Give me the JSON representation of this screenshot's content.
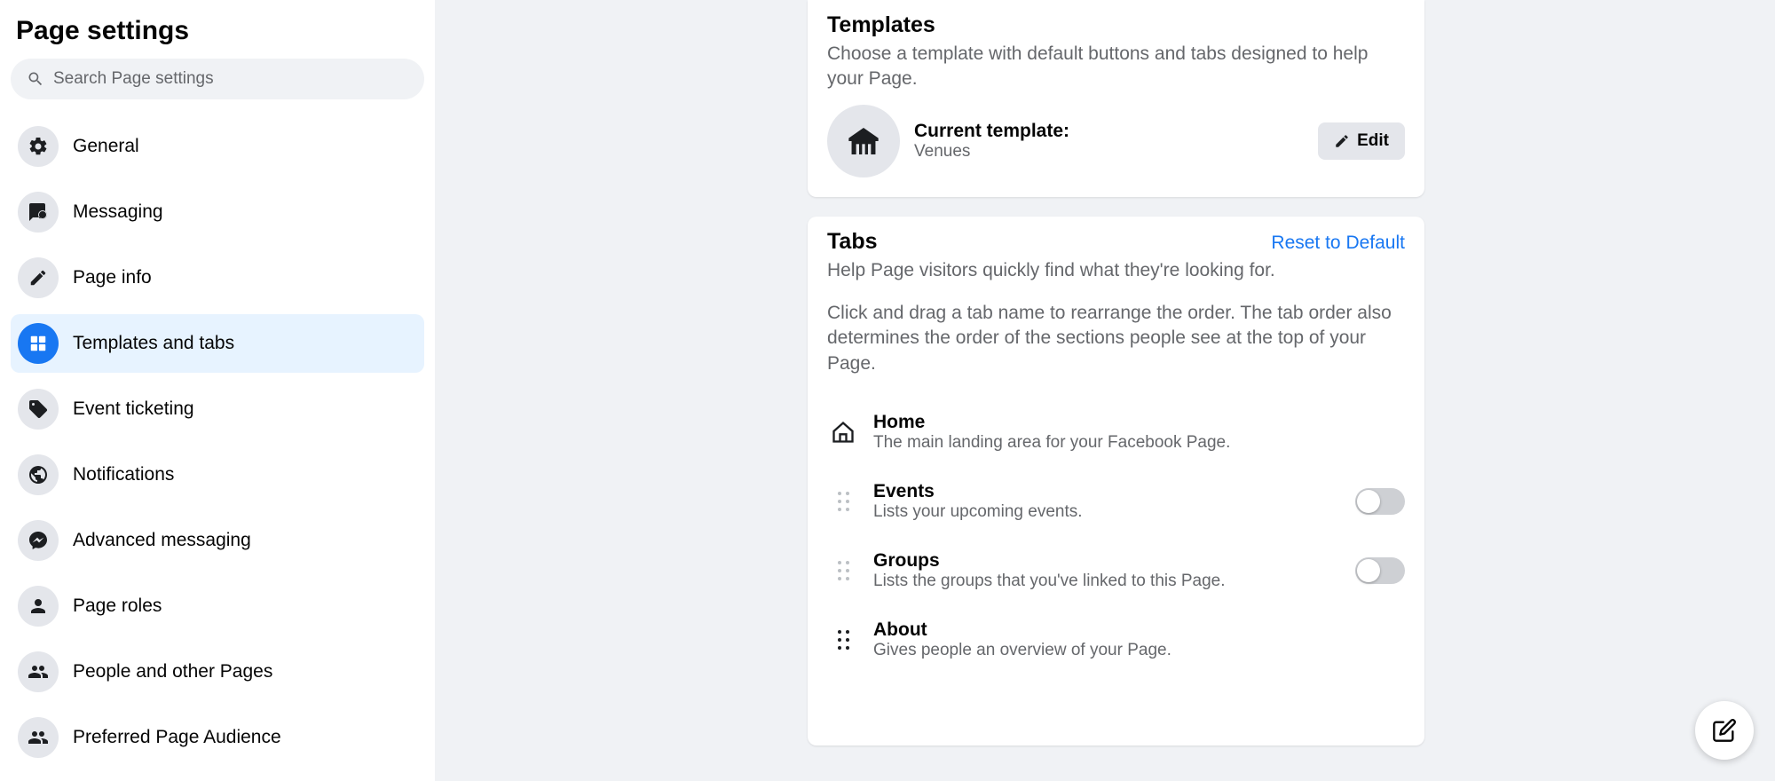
{
  "sidebar": {
    "title": "Page settings",
    "search_placeholder": "Search Page settings",
    "items": [
      {
        "label": "General",
        "icon": "gear"
      },
      {
        "label": "Messaging",
        "icon": "chat"
      },
      {
        "label": "Page info",
        "icon": "pencil"
      },
      {
        "label": "Templates and tabs",
        "icon": "grid",
        "active": true
      },
      {
        "label": "Event ticketing",
        "icon": "ticket"
      },
      {
        "label": "Notifications",
        "icon": "globe"
      },
      {
        "label": "Advanced messaging",
        "icon": "messenger"
      },
      {
        "label": "Page roles",
        "icon": "person"
      },
      {
        "label": "People and other Pages",
        "icon": "people"
      },
      {
        "label": "Preferred Page Audience",
        "icon": "people"
      }
    ]
  },
  "templates": {
    "title": "Templates",
    "subtitle": "Choose a template with default buttons and tabs designed to help your Page.",
    "current_label": "Current template:",
    "current_value": "Venues",
    "edit_label": "Edit"
  },
  "tabs": {
    "title": "Tabs",
    "reset_label": "Reset to Default",
    "subtitle1": "Help Page visitors quickly find what they're looking for.",
    "subtitle2": "Click and drag a tab name to rearrange the order. The tab order also determines the order of the sections people see at the top of your Page.",
    "items": [
      {
        "title": "Home",
        "desc": "The main landing area for your Facebook Page.",
        "icon": "home",
        "toggle": false
      },
      {
        "title": "Events",
        "desc": "Lists your upcoming events.",
        "icon": "drag-light",
        "toggle": true,
        "enabled": false
      },
      {
        "title": "Groups",
        "desc": "Lists the groups that you've linked to this Page.",
        "icon": "drag-light",
        "toggle": true,
        "enabled": false
      },
      {
        "title": "About",
        "desc": "Gives people an overview of your Page.",
        "icon": "drag-dark",
        "toggle": false
      }
    ]
  }
}
